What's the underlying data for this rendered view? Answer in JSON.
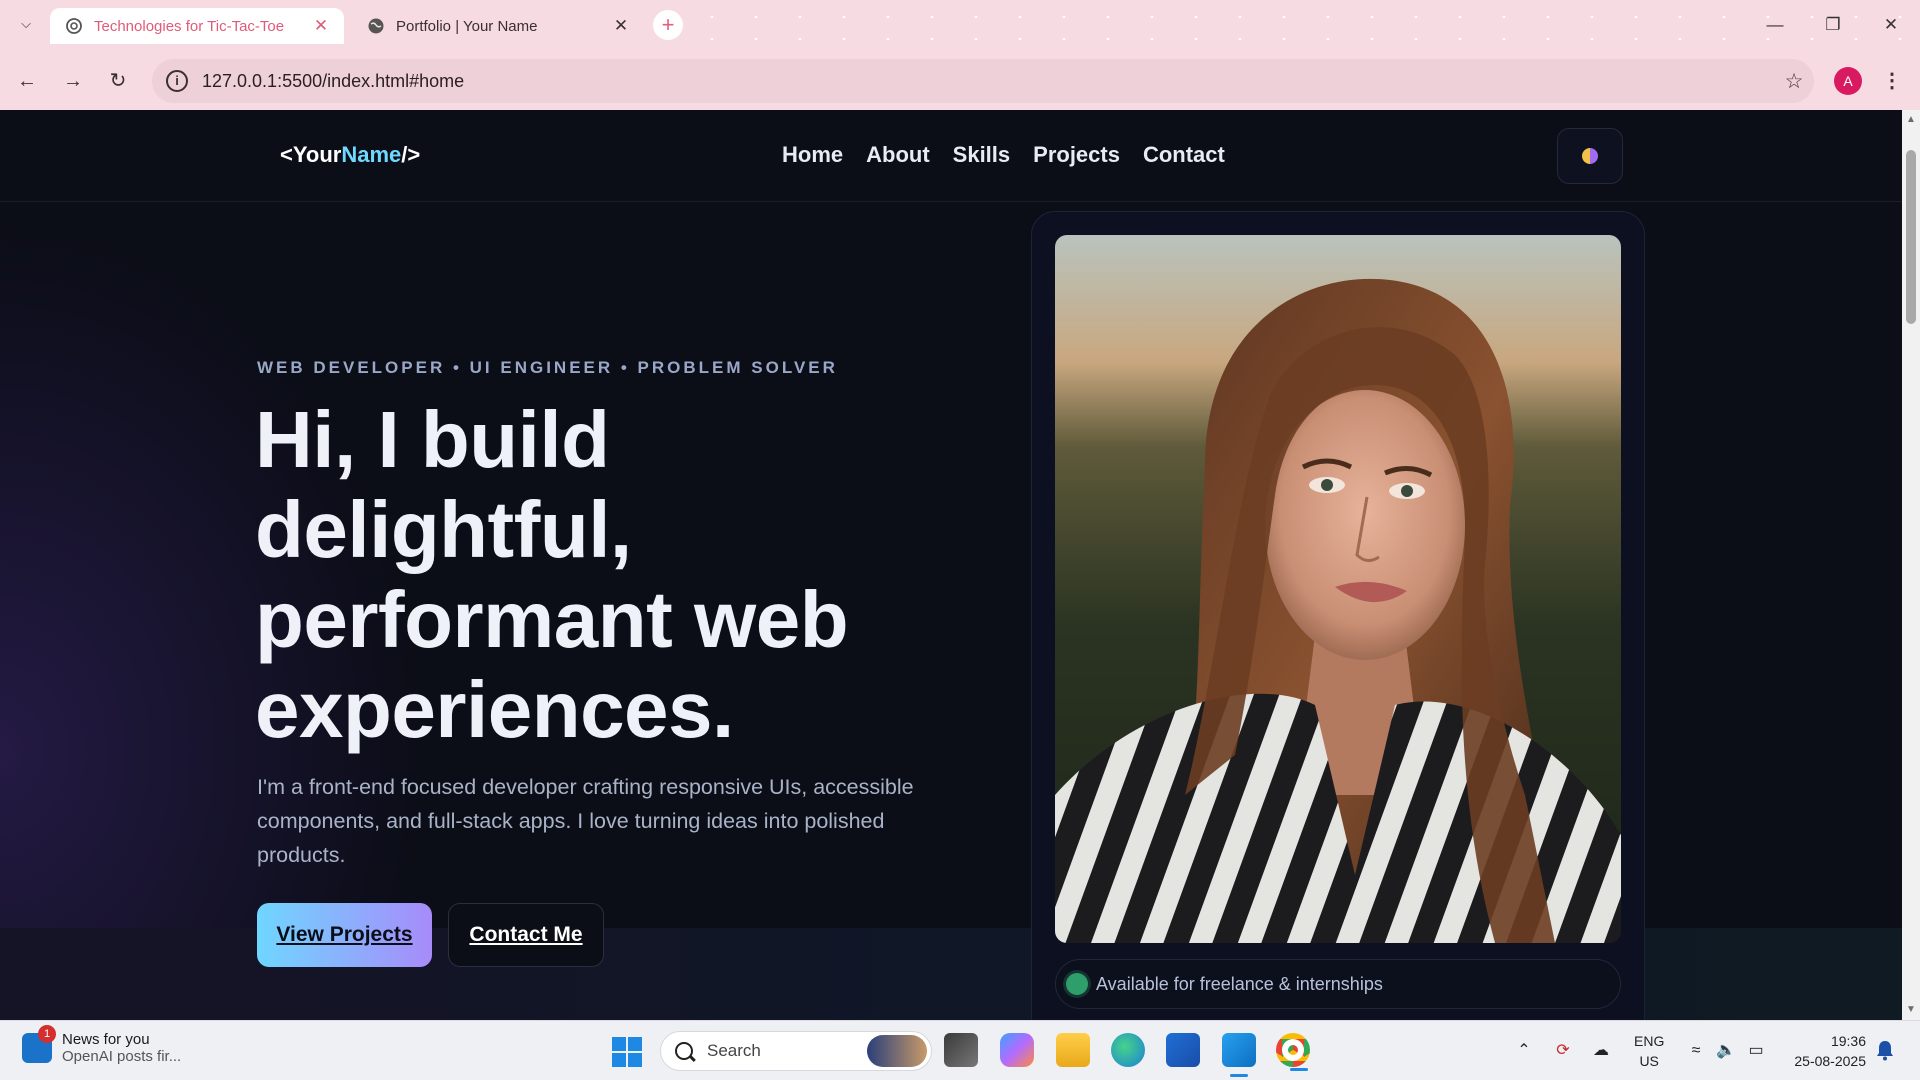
{
  "browser": {
    "tabs": [
      {
        "title": "Technologies for Tic-Tac-Toe",
        "active": true,
        "favicon": "openai-icon"
      },
      {
        "title": "Portfolio | Your Name",
        "active": false,
        "favicon": "globe-icon"
      }
    ],
    "new_tab_label": "+",
    "url": "127.0.0.1:5500/index.html#home",
    "profile_initial": "A",
    "colors": {
      "frame": "#f7dbe2",
      "active_tab_text": "#e25a79",
      "profile": "#d81b60"
    }
  },
  "site": {
    "logo": {
      "open": "<Your",
      "accent": "Name",
      "close": "/>"
    },
    "nav": [
      "Home",
      "About",
      "Skills",
      "Projects",
      "Contact"
    ],
    "theme_toggle_icon": "theme-toggle-icon",
    "hero": {
      "eyebrow": "WEB DEVELOPER • UI ENGINEER • PROBLEM SOLVER",
      "headline_lines": [
        "Hi, I build",
        "delightful,",
        "performant web",
        "experiences."
      ],
      "lede": "I'm a front-end focused developer crafting responsive UIs, accessible components, and full-stack apps. I love turning ideas into polished products.",
      "primary_cta": "View Projects",
      "secondary_cta": "Contact Me"
    },
    "availability": "Available for freelance & internships",
    "colors": {
      "background": "#0b0d17",
      "accent": "#6fd8ff",
      "accent_2": "#a78bfa",
      "status": "#2e9e6a"
    }
  },
  "taskbar": {
    "news_badge": "1",
    "news_title": "News for you",
    "news_sub": "OpenAI posts fir...",
    "search_placeholder": "Search",
    "lang_1": "ENG",
    "lang_2": "US",
    "time": "19:36",
    "date": "25-08-2025"
  }
}
